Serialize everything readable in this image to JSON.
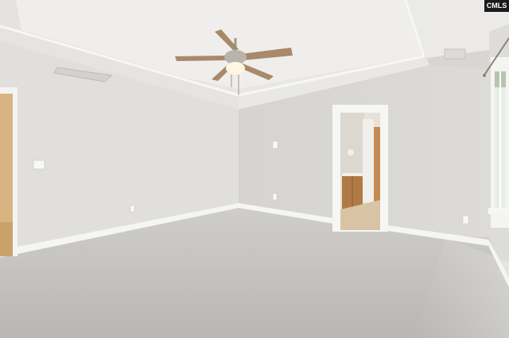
{
  "scene": {
    "description_kind": "photo",
    "watermark": {
      "text": "CMLS"
    },
    "colors": {
      "ceiling": "#e7e6e3",
      "tray_ceiling": "#eeedeb",
      "left_wall": "#e2e0dd",
      "back_wall": "#d9d7d3",
      "right_wall": "#dfddd9",
      "carpet": "#c3c1bd",
      "trim": "#f7f7f5",
      "hall_wood": "#b07a46",
      "hall_floor": "#d8c3a4",
      "fan_blade": "#a8896a",
      "fan_metal": "#b8b3ab"
    }
  }
}
